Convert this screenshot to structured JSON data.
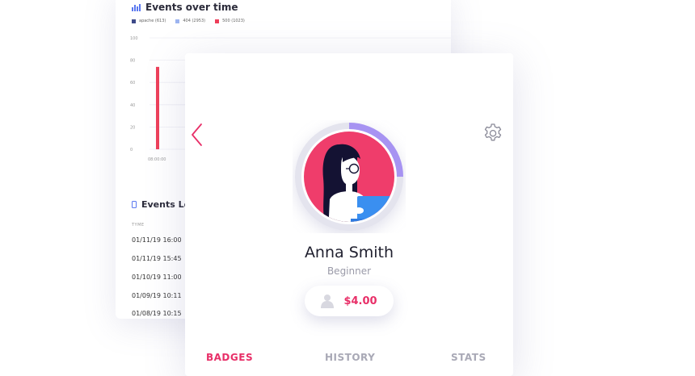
{
  "dashboard": {
    "chart_title": "Events over time",
    "chart_data": {
      "type": "bar",
      "categories": [
        "08:00:00"
      ],
      "series": [
        {
          "name": "apache (613)",
          "values": [
            0
          ]
        },
        {
          "name": "404 (2953)",
          "values": [
            0
          ]
        },
        {
          "name": "500 (1023)",
          "values": [
            74
          ]
        }
      ],
      "title": "Events over time",
      "yticks": [
        "100",
        "80",
        "60",
        "40",
        "20",
        "0"
      ],
      "ylim": [
        0,
        100
      ],
      "legend": "top-left",
      "colors": {
        "apache": "#3e4a89",
        "404": "#9db4f0",
        "500": "#ee3f5a"
      }
    },
    "log": {
      "title": "Events Lo",
      "column_header": "TYME",
      "rows": [
        "01/11/19 16:00",
        "01/11/19 15:45",
        "01/10/19 11:00",
        "01/09/19 10:11",
        "01/08/19 10:15"
      ]
    }
  },
  "profile": {
    "name": "Anna Smith",
    "level": "Beginner",
    "balance": "$4.00",
    "progress_fraction": 0.25,
    "accent_color": "#e82f68",
    "tabs": [
      {
        "label": "BADGES",
        "active": true
      },
      {
        "label": "HISTORY",
        "active": false
      },
      {
        "label": "STATS",
        "active": false
      }
    ],
    "icons": {
      "back": "chevron-left-icon",
      "settings": "gear-icon",
      "balance": "user-icon"
    }
  }
}
